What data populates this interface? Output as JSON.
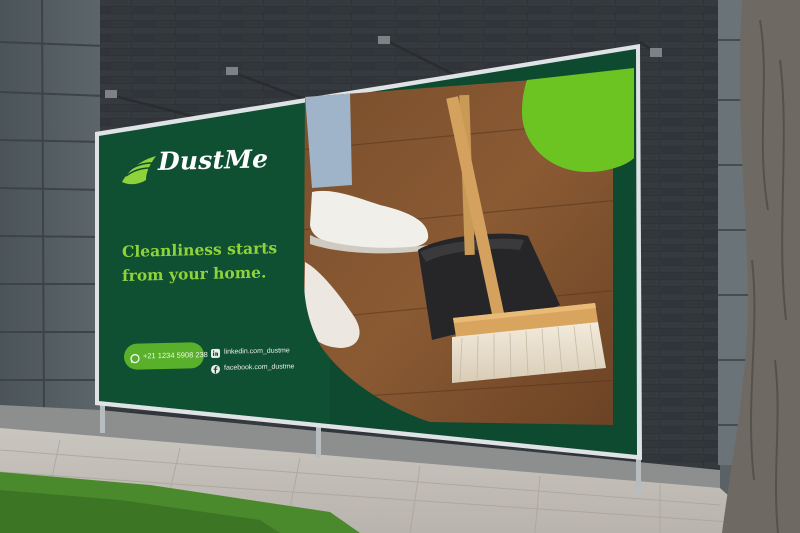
{
  "billboard": {
    "brand_name": "DustMe",
    "brand_icon": "wing-swoosh-icon",
    "headline_line1": "Cleanliness starts",
    "headline_line2": "from your home.",
    "phone": "+21 1234 5908 238",
    "phone_icon": "whatsapp-icon",
    "linkedin": "linkedin.com_dustme",
    "linkedin_icon": "linkedin-icon",
    "facebook": "facebook.com_dustme",
    "facebook_icon": "facebook-icon",
    "colors": {
      "panel_green": "#0e4a30",
      "accent_green": "#6cc423",
      "text_green": "#8fd33a",
      "white": "#ffffff"
    }
  }
}
